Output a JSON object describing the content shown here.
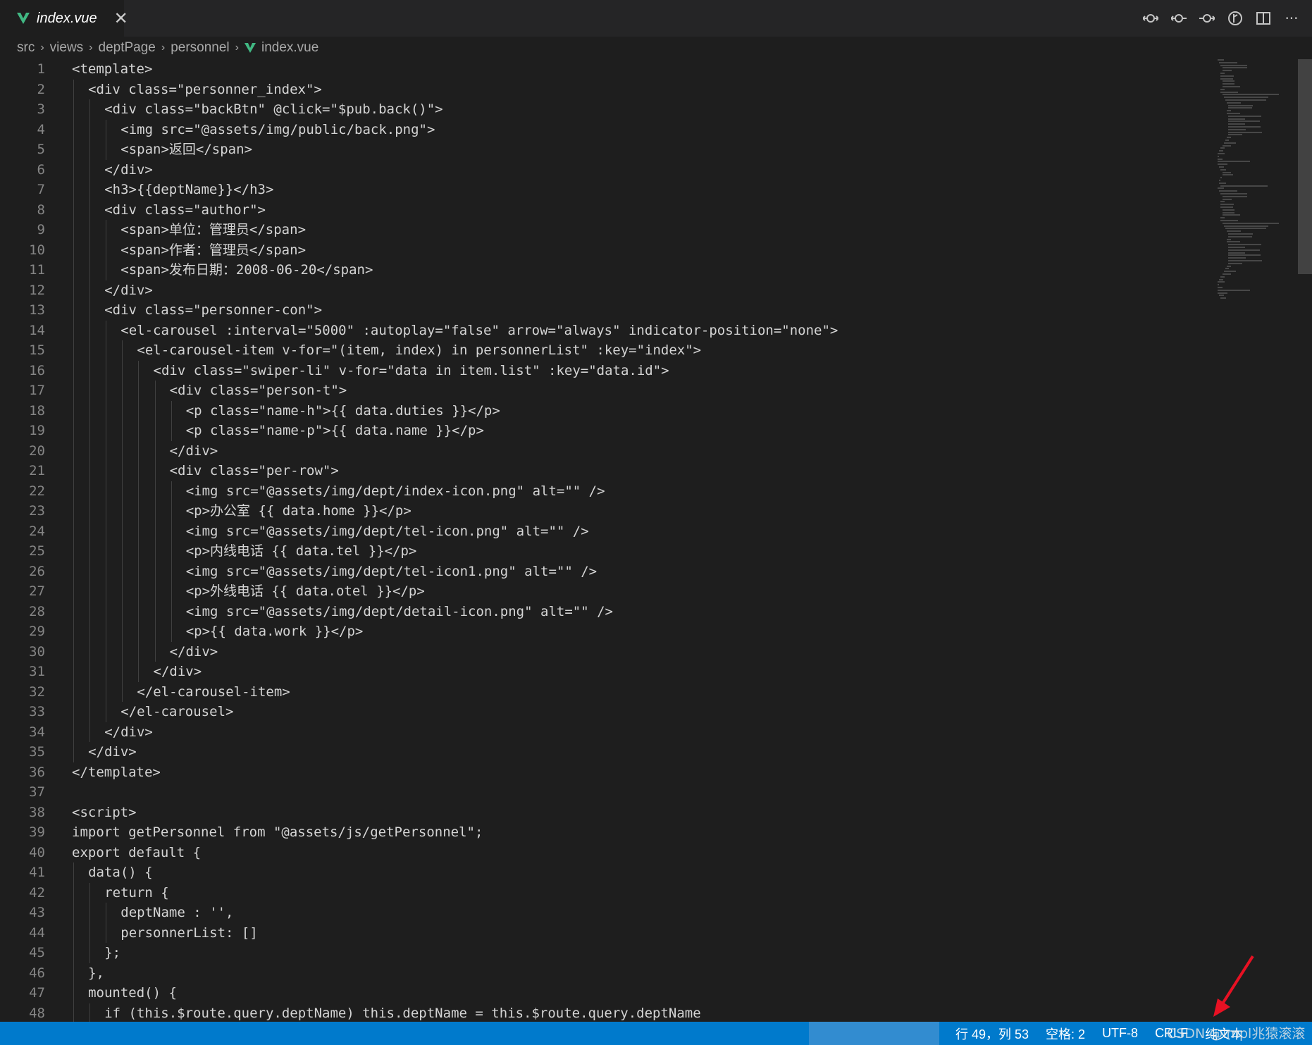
{
  "tab": {
    "label": "index.vue",
    "close": "✕"
  },
  "breadcrumb": [
    "src",
    "views",
    "deptPage",
    "personnel",
    "index.vue"
  ],
  "toolbar": {
    "icons": [
      "git-compare-icon",
      "go-back-icon",
      "go-forward-icon",
      "open-changes-icon",
      "split-editor-icon",
      "more-actions-icon"
    ],
    "more": "···"
  },
  "code": [
    {
      "n": "1",
      "indent": 0,
      "t": "<template>"
    },
    {
      "n": "2",
      "indent": 1,
      "t": "<div class=\"personner_index\">"
    },
    {
      "n": "3",
      "indent": 2,
      "t": "<div class=\"backBtn\" @click=\"$pub.back()\">"
    },
    {
      "n": "4",
      "indent": 3,
      "t": "<img src=\"@assets/img/public/back.png\">"
    },
    {
      "n": "5",
      "indent": 3,
      "t": "<span>返回</span>"
    },
    {
      "n": "6",
      "indent": 2,
      "t": "</div>"
    },
    {
      "n": "7",
      "indent": 2,
      "t": "<h3>{{deptName}}</h3>"
    },
    {
      "n": "8",
      "indent": 2,
      "t": "<div class=\"author\">"
    },
    {
      "n": "9",
      "indent": 3,
      "t": "<span>单位：管理员</span>"
    },
    {
      "n": "10",
      "indent": 3,
      "t": "<span>作者：管理员</span>"
    },
    {
      "n": "11",
      "indent": 3,
      "t": "<span>发布日期：2008-06-20</span>"
    },
    {
      "n": "12",
      "indent": 2,
      "t": "</div>"
    },
    {
      "n": "13",
      "indent": 2,
      "t": "<div class=\"personner-con\">"
    },
    {
      "n": "14",
      "indent": 3,
      "t": "<el-carousel :interval=\"5000\" :autoplay=\"false\" arrow=\"always\" indicator-position=\"none\">"
    },
    {
      "n": "15",
      "indent": 4,
      "t": "<el-carousel-item v-for=\"(item, index) in personnerList\" :key=\"index\">"
    },
    {
      "n": "16",
      "indent": 5,
      "t": "<div class=\"swiper-li\" v-for=\"data in item.list\" :key=\"data.id\">"
    },
    {
      "n": "17",
      "indent": 6,
      "t": "<div class=\"person-t\">"
    },
    {
      "n": "18",
      "indent": 7,
      "t": "<p class=\"name-h\">{{ data.duties }}</p>"
    },
    {
      "n": "19",
      "indent": 7,
      "t": "<p class=\"name-p\">{{ data.name }}</p>"
    },
    {
      "n": "20",
      "indent": 6,
      "t": "</div>"
    },
    {
      "n": "21",
      "indent": 6,
      "t": "<div class=\"per-row\">"
    },
    {
      "n": "22",
      "indent": 7,
      "t": "<img src=\"@assets/img/dept/index-icon.png\" alt=\"\" />"
    },
    {
      "n": "23",
      "indent": 7,
      "t": "<p>办公室 {{ data.home }}</p>"
    },
    {
      "n": "24",
      "indent": 7,
      "t": "<img src=\"@assets/img/dept/tel-icon.png\" alt=\"\" />"
    },
    {
      "n": "25",
      "indent": 7,
      "t": "<p>内线电话 {{ data.tel }}</p>"
    },
    {
      "n": "26",
      "indent": 7,
      "t": "<img src=\"@assets/img/dept/tel-icon1.png\" alt=\"\" />"
    },
    {
      "n": "27",
      "indent": 7,
      "t": "<p>外线电话 {{ data.otel }}</p>"
    },
    {
      "n": "28",
      "indent": 7,
      "t": "<img src=\"@assets/img/dept/detail-icon.png\" alt=\"\" />"
    },
    {
      "n": "29",
      "indent": 7,
      "t": "<p>{{ data.work }}</p>"
    },
    {
      "n": "30",
      "indent": 6,
      "t": "</div>"
    },
    {
      "n": "31",
      "indent": 5,
      "t": "</div>"
    },
    {
      "n": "32",
      "indent": 4,
      "t": "</el-carousel-item>"
    },
    {
      "n": "33",
      "indent": 3,
      "t": "</el-carousel>"
    },
    {
      "n": "34",
      "indent": 2,
      "t": "</div>"
    },
    {
      "n": "35",
      "indent": 1,
      "t": "</div>"
    },
    {
      "n": "36",
      "indent": 0,
      "t": "</template>"
    },
    {
      "n": "37",
      "indent": 0,
      "t": ""
    },
    {
      "n": "38",
      "indent": 0,
      "t": "<script>"
    },
    {
      "n": "39",
      "indent": 0,
      "t": "import getPersonnel from \"@assets/js/getPersonnel\";"
    },
    {
      "n": "40",
      "indent": 0,
      "t": "export default {"
    },
    {
      "n": "41",
      "indent": 1,
      "t": "data() {"
    },
    {
      "n": "42",
      "indent": 2,
      "t": "return {"
    },
    {
      "n": "43",
      "indent": 3,
      "t": "deptName : '',"
    },
    {
      "n": "44",
      "indent": 3,
      "t": "personnerList: []"
    },
    {
      "n": "45",
      "indent": 2,
      "t": "};"
    },
    {
      "n": "46",
      "indent": 1,
      "t": "},"
    },
    {
      "n": "47",
      "indent": 1,
      "t": "mounted() {"
    },
    {
      "n": "48",
      "indent": 2,
      "t": "if (this.$route.query.deptName) this.deptName = this.$route.query.deptName"
    }
  ],
  "status": {
    "position": "行 49，列 53",
    "spaces": "空格: 2",
    "encoding": "UTF-8",
    "eol": "CRLF",
    "language": "纯文本",
    "watermark": "CSDN @impl兆猿滚滚"
  },
  "colors": {
    "accent": "#007acc",
    "vue": "#41b883",
    "annotation": "#e81123"
  }
}
